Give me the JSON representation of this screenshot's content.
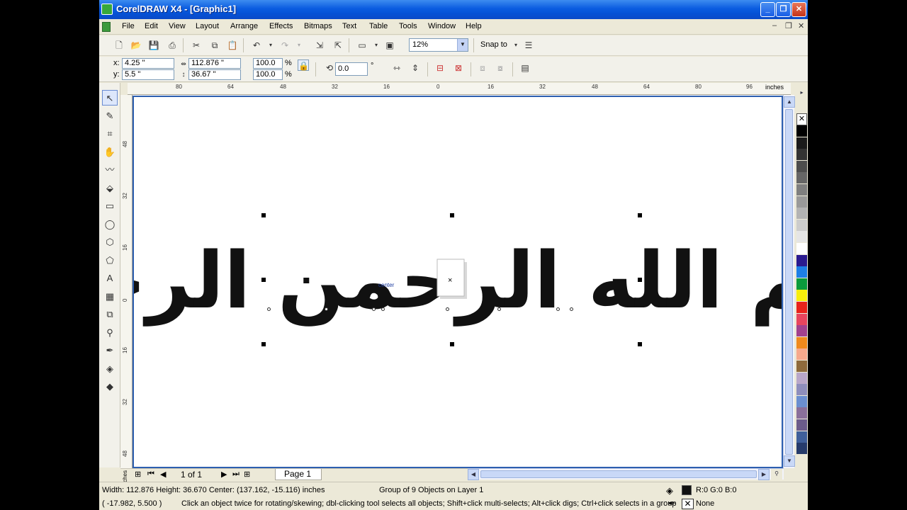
{
  "window": {
    "title": "CorelDRAW X4 - [Graphic1]"
  },
  "menu": [
    "File",
    "Edit",
    "View",
    "Layout",
    "Arrange",
    "Effects",
    "Bitmaps",
    "Text",
    "Table",
    "Tools",
    "Window",
    "Help"
  ],
  "toolbar": {
    "zoom_value": "12%",
    "snap_label": "Snap to"
  },
  "properties": {
    "x_label": "x:",
    "y_label": "y:",
    "x_value": "4.25 \"",
    "y_value": "5.5 \"",
    "width_value": "112.876 \"",
    "height_value": "36.67 \"",
    "scale_x": "100.0",
    "scale_y": "100.0",
    "percent_symbol": "%",
    "rotation": "0.0",
    "degree_symbol": "°"
  },
  "rulers": {
    "horizontal_ticks": [
      "80",
      "64",
      "48",
      "32",
      "16",
      "0",
      "16",
      "32",
      "48",
      "64",
      "80",
      "96"
    ],
    "vertical_ticks": [
      "48",
      "32",
      "16",
      "0",
      "16",
      "32",
      "48"
    ],
    "units": "inches"
  },
  "canvas": {
    "calligraphy": "بسم الله الرحمن الرحيم",
    "center_label": "center"
  },
  "page_nav": {
    "page_count": "1 of 1",
    "page_tab": "Page 1"
  },
  "status": {
    "dimensions": "Width: 112.876  Height: 36.670  Center: (137.162, -15.116)  inches",
    "selection": "Group of 9 Objects on Layer 1",
    "fill_color": "R:0 G:0 B:0",
    "cursor_position": "( -17.982, 5.500 )",
    "hint": "Click an object twice for rotating/skewing; dbl-clicking tool selects all objects; Shift+click multi-selects; Alt+click digs; Ctrl+click selects in a group",
    "outline": "None"
  },
  "palette_colors": [
    "#000000",
    "#1a1a1a",
    "#333333",
    "#4d4d4d",
    "#666666",
    "#7f7f7f",
    "#999999",
    "#b3b3b3",
    "#cccccc",
    "#e5e5e5",
    "#ffffff",
    "#2b1b8f",
    "#1e7fe6",
    "#0b9b3c",
    "#f7ee0b",
    "#e8231b",
    "#e8455e",
    "#a3418e",
    "#f08a1d",
    "#f6a98c",
    "#8e6a3c",
    "#b9a7c9",
    "#8e8ebc",
    "#6b8fd0",
    "#8a6f9a",
    "#6b5b8a",
    "#3f5f9a",
    "#263b6b"
  ]
}
